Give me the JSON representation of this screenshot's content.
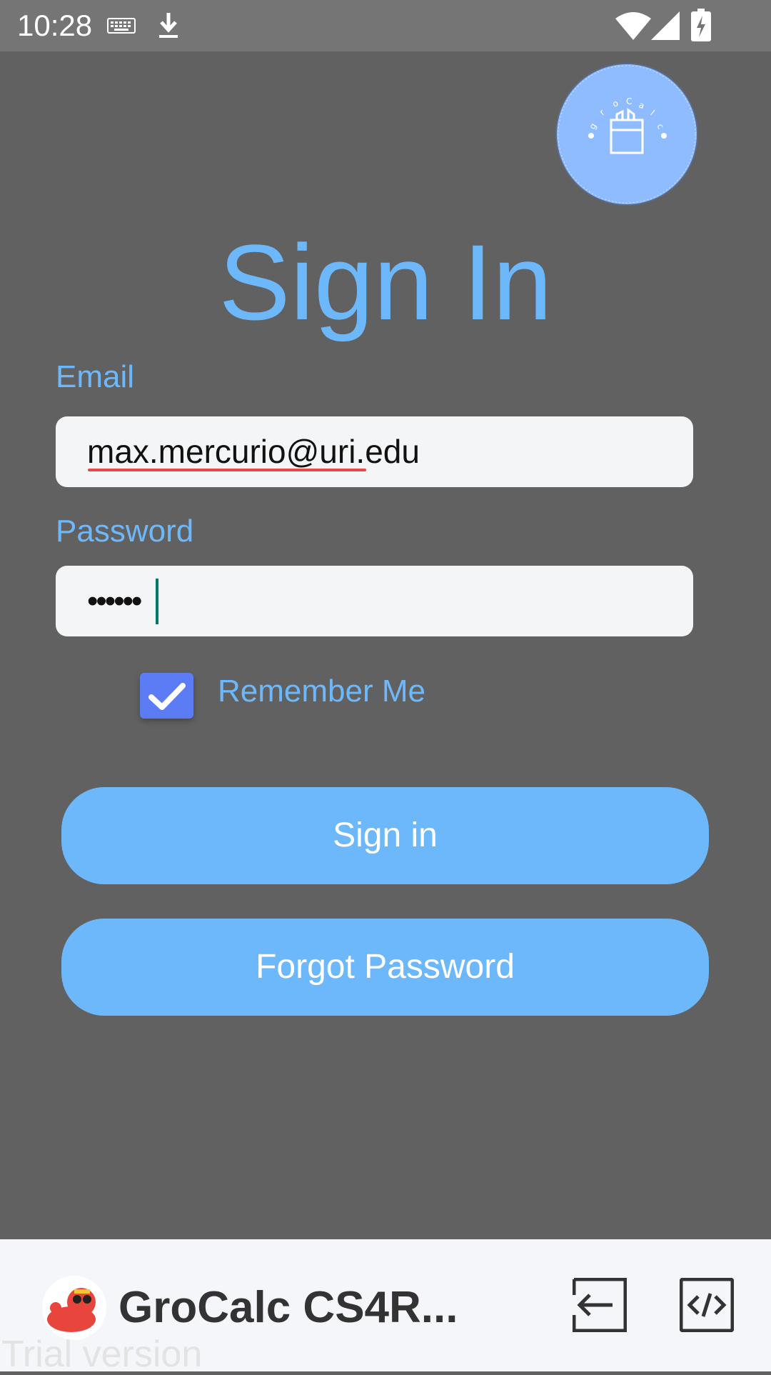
{
  "status_bar": {
    "time": "10:28",
    "icons": [
      "keyboard-icon",
      "download-icon",
      "wifi-icon",
      "signal-icon",
      "battery-charging-icon"
    ]
  },
  "logo": {
    "text": "groCalc",
    "icon": "grocery-bag-icon",
    "color": "#8ebcff"
  },
  "page": {
    "title": "Sign In"
  },
  "form": {
    "email_label": "Email",
    "email_value": "max.mercurio@uri.edu",
    "password_label": "Password",
    "password_value": "••••••",
    "remember_label": "Remember Me",
    "remember_checked": true
  },
  "buttons": {
    "sign_in": "Sign in",
    "forgot_password": "Forgot Password"
  },
  "bottom_bar": {
    "app_name": "GroCalc CS4R...",
    "watermark": "Trial version",
    "actions": [
      "exit-icon",
      "code-icon"
    ]
  },
  "colors": {
    "background": "#616161",
    "accent": "#6db8fb",
    "checkbox": "#5b7cf5",
    "status_bar": "#757575"
  }
}
